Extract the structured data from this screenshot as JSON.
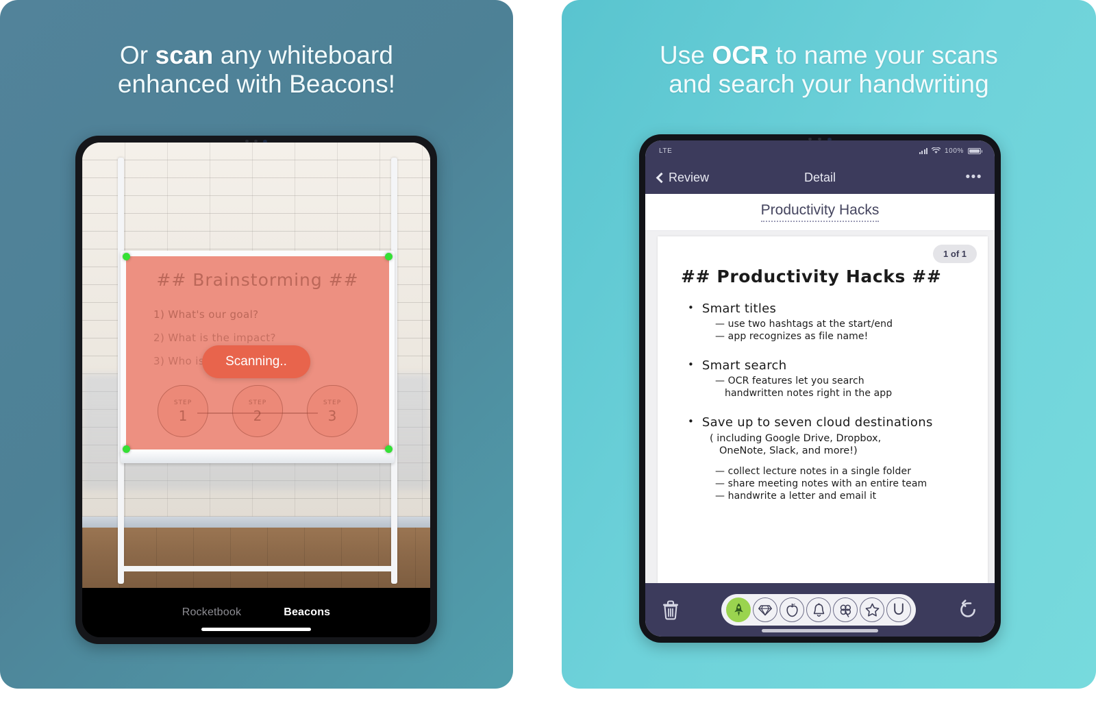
{
  "theme": {
    "left_card_bg": "#4d8196",
    "right_card_bg": "#6ed2da",
    "page_bg": "#ffffff",
    "nav_purple": "#3c3b5c",
    "accent_green": "#9ad44f",
    "scan_orange": "#e8644c",
    "corner_dot_green": "#35e035"
  },
  "left_panel": {
    "headline": {
      "line1_pre": "Or ",
      "line1_bold": "scan",
      "line1_post": " any whiteboard",
      "line2": "enhanced with Beacons!"
    },
    "device": {
      "camera_view": {
        "whiteboard": {
          "title": "## Brainstorming ##",
          "questions": [
            "1) What's our goal?",
            "2) What is the impact?",
            "3) Who is involved?"
          ],
          "steps": [
            {
              "label": "STEP",
              "number": "1"
            },
            {
              "label": "STEP",
              "number": "2"
            },
            {
              "label": "STEP",
              "number": "3"
            }
          ]
        },
        "scanning_label": "Scanning..",
        "corner_markers": 4
      },
      "tabs": [
        {
          "label": "Rocketbook",
          "active": false
        },
        {
          "label": "Beacons",
          "active": true
        }
      ]
    }
  },
  "right_panel": {
    "headline": {
      "line1_pre": "Use ",
      "line1_bold": "OCR",
      "line1_post": " to name your scans",
      "line2": "and search your handwriting"
    },
    "device": {
      "status_bar": {
        "carrier": "LTE",
        "battery_percent": "100%"
      },
      "nav_bar": {
        "back_label": "Review",
        "title": "Detail",
        "more_label": "•••"
      },
      "document": {
        "title": "Productivity Hacks",
        "page_count": "1 of 1",
        "note": {
          "heading": "## Productivity Hacks ##",
          "bullets": [
            {
              "title": "Smart titles",
              "subs": [
                "— use two hashtags at the start/end",
                "— app recognizes as file name!"
              ]
            },
            {
              "title": "Smart search",
              "subs": [
                "— OCR features let you search",
                "handwritten notes right in the app"
              ]
            },
            {
              "title": "Save up to seven cloud destinations",
              "paren_line1": "( including Google Drive, Dropbox,",
              "paren_line2": "OneNote, Slack, and more!)",
              "subs": [
                "— collect lecture notes in a single folder",
                "— share meeting notes with an entire team",
                "— handwrite a letter and email it"
              ]
            }
          ]
        }
      },
      "toolbar": {
        "delete_icon": "trash-icon",
        "rotate_icon": "rotate-counterclockwise-icon",
        "destinations": [
          {
            "name": "rocket",
            "glyph": "🚀",
            "selected": true
          },
          {
            "name": "diamond",
            "glyph": "♦",
            "selected": false
          },
          {
            "name": "apple",
            "glyph": "🍎",
            "selected": false
          },
          {
            "name": "bell",
            "glyph": "🔔",
            "selected": false
          },
          {
            "name": "clover",
            "glyph": "♣",
            "selected": false
          },
          {
            "name": "star",
            "glyph": "★",
            "selected": false
          },
          {
            "name": "horseshoe",
            "glyph": "∪",
            "selected": false
          }
        ]
      }
    }
  }
}
